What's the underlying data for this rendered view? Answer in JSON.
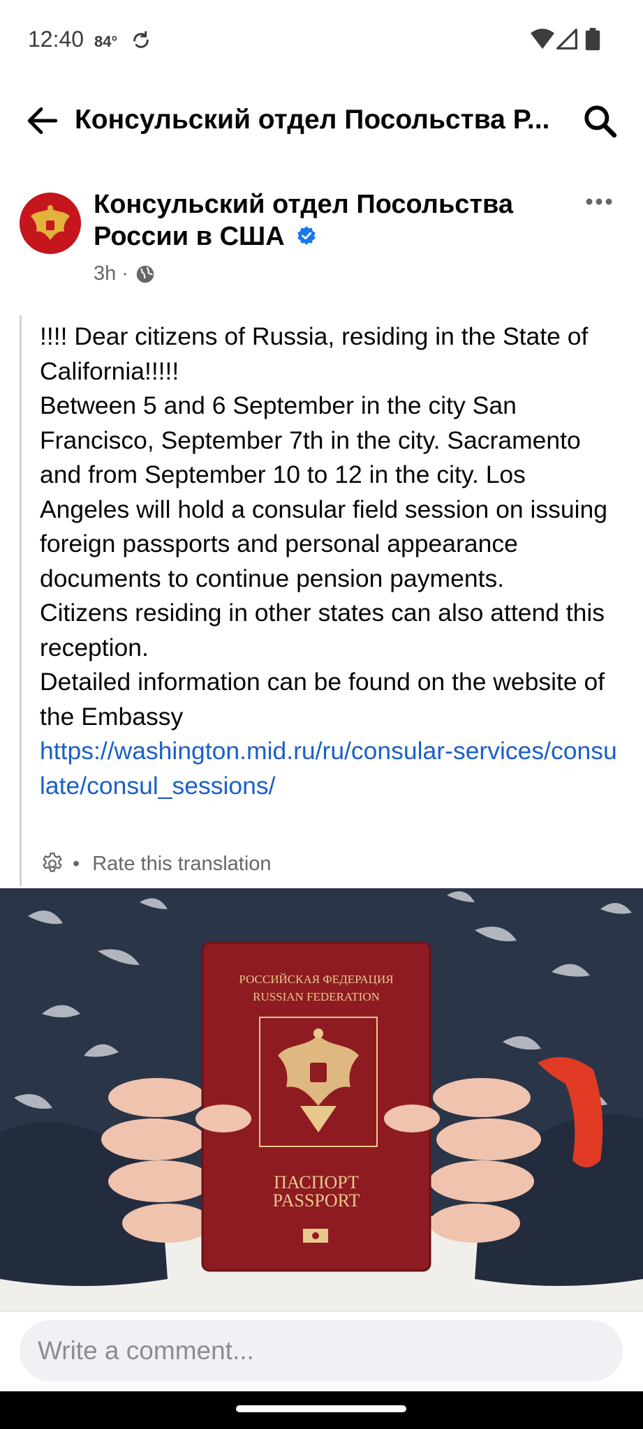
{
  "status_bar": {
    "time": "12:40",
    "temperature": "84°",
    "icons": [
      "sync-icon",
      "wifi-icon",
      "cell-signal-icon",
      "battery-icon"
    ]
  },
  "header": {
    "title": "Консульский отдел Посольства Р...",
    "back_icon": "arrow-left-icon",
    "search_icon": "search-icon"
  },
  "post": {
    "page_name": "Консульский отдел Посольства России в США",
    "verified": true,
    "time": "3h",
    "separator": "·",
    "audience_icon": "globe-icon",
    "body": [
      "!!!! Dear citizens of Russia, residing in the State of California!!!!!",
      "Between 5 and 6 September in the city San Francisco, September 7th in the city. Sacramento and from September 10 to 12 in the city. Los Angeles will hold a consular field session on issuing foreign passports and personal appearance documents to continue pension payments.",
      "Citizens residing in other states can also attend this reception.",
      "Detailed information can be found on the website of the Embassy"
    ],
    "link": "https://washington.mid.ru/ru/consular-services/consulate/consul_sessions/",
    "translation_sep": "•",
    "rate_translation": "Rate this translation",
    "photo": {
      "passport_top_ru": "РОССИЙСКАЯ ФЕДЕРАЦИЯ",
      "passport_top_en": "RUSSIAN FEDERATION",
      "passport_bottom_ru": "ПАСПОРТ",
      "passport_bottom_en": "PASSPORT"
    }
  },
  "comment": {
    "placeholder": "Write a comment..."
  },
  "colors": {
    "link": "#1a5fc8",
    "verified": "#1877f2",
    "passport": "#8e1b22",
    "gold": "#e8c98b",
    "muted_text": "#65676b"
  }
}
